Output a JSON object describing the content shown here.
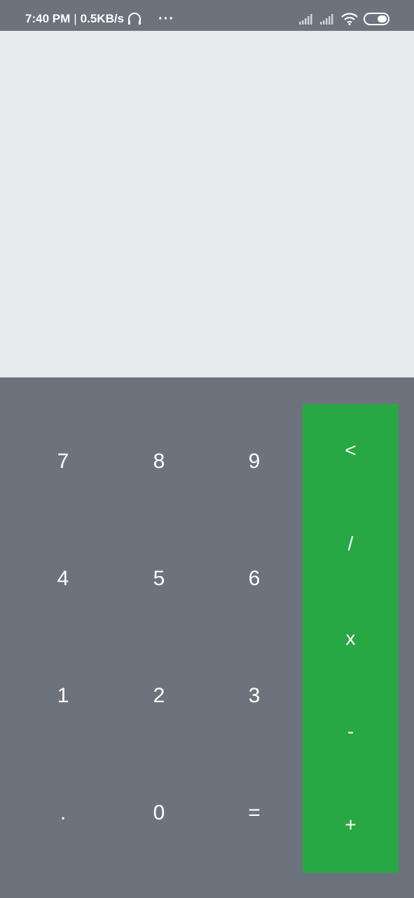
{
  "status_bar": {
    "time": "7:40 PM",
    "separator": "|",
    "network_speed": "0.5KB/s",
    "more": "···",
    "icons": [
      "headset-icon",
      "signal-icon",
      "signal-icon",
      "wifi-icon",
      "battery-icon"
    ]
  },
  "display": {
    "value": ""
  },
  "keys": {
    "row1": [
      "7",
      "8",
      "9"
    ],
    "row2": [
      "4",
      "5",
      "6"
    ],
    "row3": [
      "1",
      "2",
      "3"
    ],
    "row4": [
      ".",
      "0",
      "="
    ]
  },
  "operators": [
    "<",
    "/",
    "x",
    "-",
    "+"
  ],
  "colors": {
    "keypad_bg": "#6c737c",
    "display_bg": "#e6eaed",
    "operator_bg": "#28a745",
    "key_text": "#ffffff"
  }
}
